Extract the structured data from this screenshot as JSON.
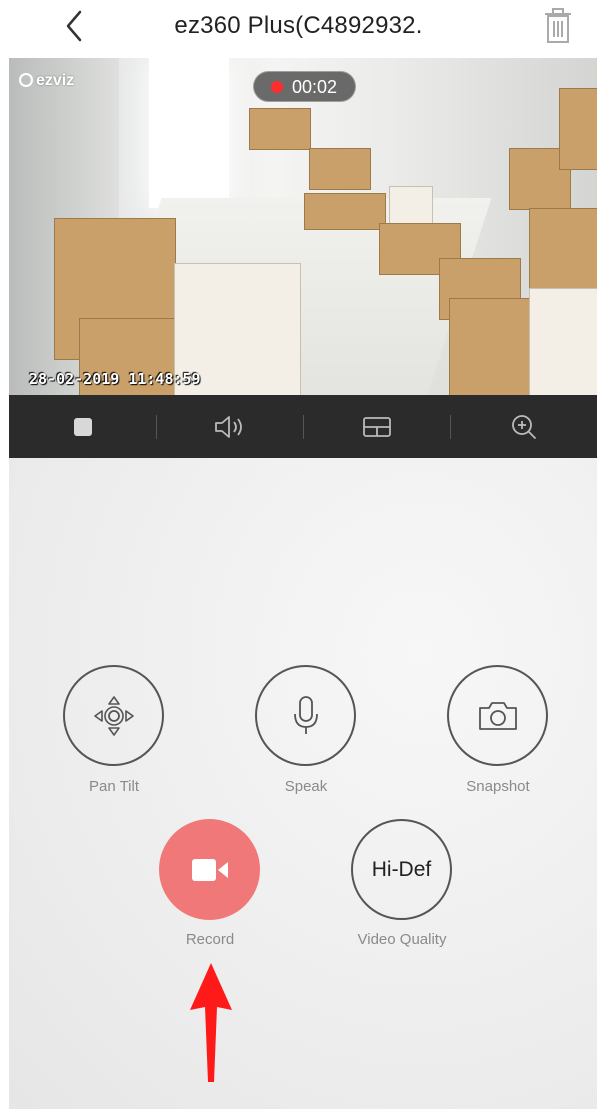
{
  "header": {
    "title": "ez360 Plus(C4892932.",
    "back_icon": "chevron-left-icon",
    "trash_icon": "trash-icon"
  },
  "video": {
    "logo_text": "ezviz",
    "recording_time": "00:02",
    "timestamp": "28-02-2019 11:48:59",
    "rec_color": "#ff2d2d"
  },
  "toolbar": {
    "items": [
      "stop-icon",
      "volume-icon",
      "layout-icon",
      "zoom-in-icon"
    ]
  },
  "controls": {
    "pan_tilt_label": "Pan Tilt",
    "speak_label": "Speak",
    "snapshot_label": "Snapshot",
    "record_label": "Record",
    "video_quality_label": "Video Quality",
    "video_quality_value": "Hi-Def",
    "record_color": "#f07878"
  },
  "annotation": {
    "arrow_color": "#ff1a1a"
  }
}
